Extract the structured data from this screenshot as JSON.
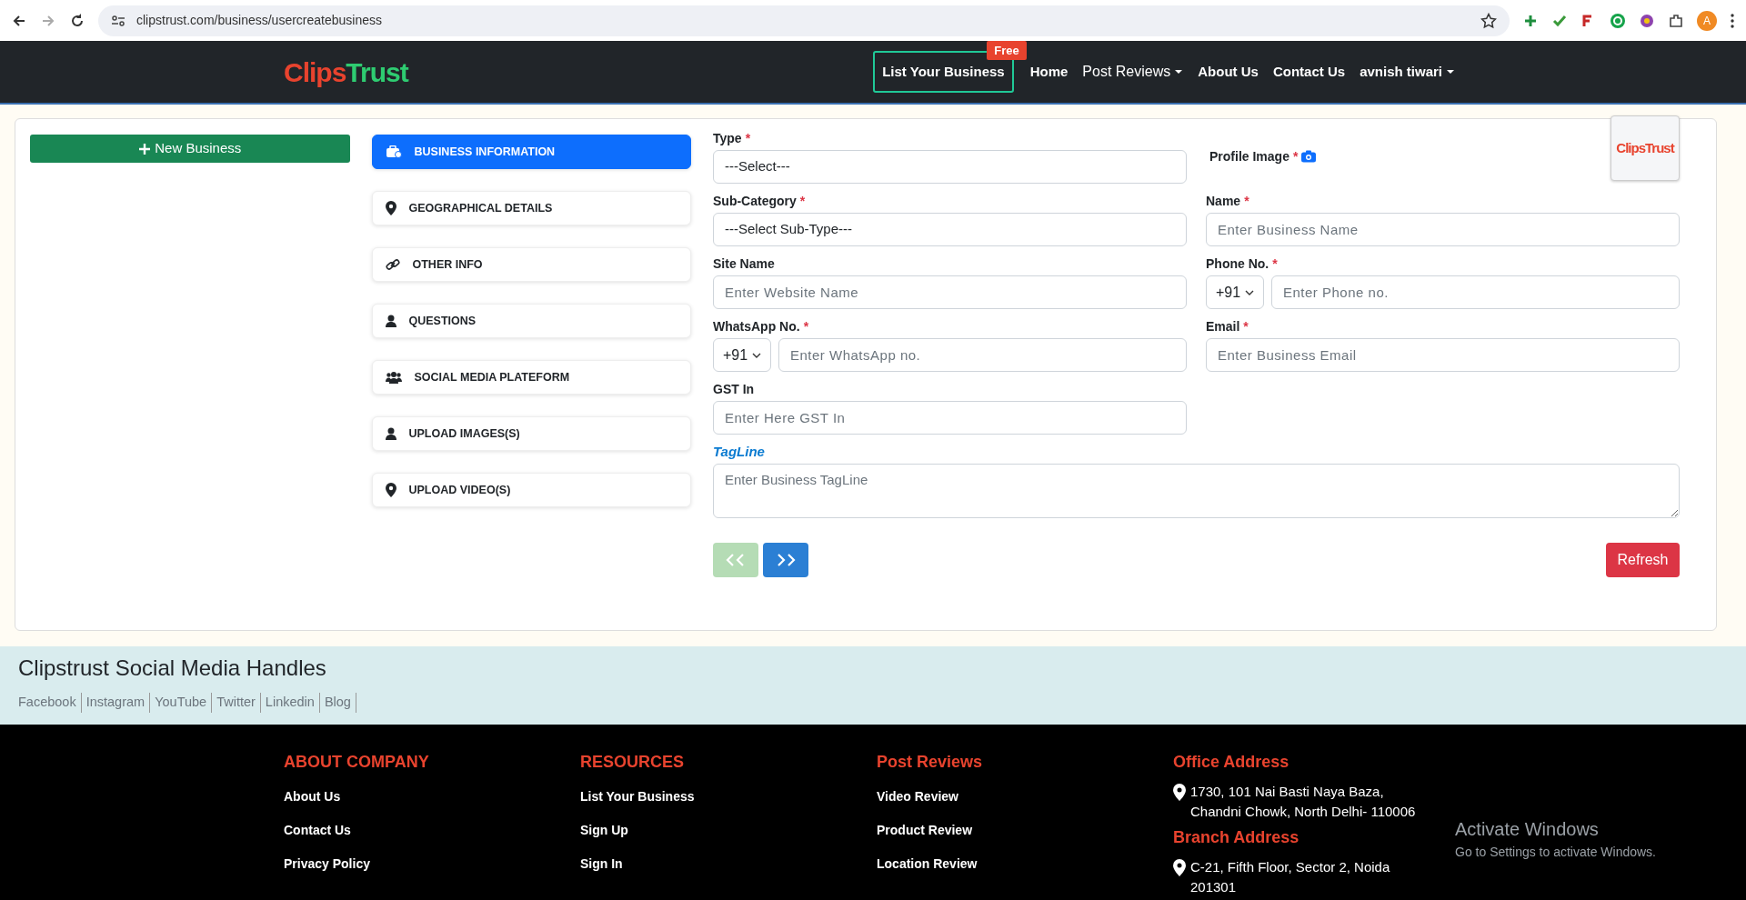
{
  "browser": {
    "url": "clipstrust.com/business/usercreatebusiness",
    "avatar": "A"
  },
  "navbar": {
    "logo": {
      "first": "Clips",
      "second": "Trust"
    },
    "items": [
      {
        "label": "List Your Business",
        "kind": "boxed",
        "badge": "Free"
      },
      {
        "label": "Home",
        "kind": "link"
      },
      {
        "label": "Post Reviews",
        "kind": "dropdown"
      },
      {
        "label": "About Us",
        "kind": "link"
      },
      {
        "label": "Contact Us",
        "kind": "link"
      },
      {
        "label": "avnish tiwari",
        "kind": "dropdown"
      }
    ]
  },
  "new_business_button": "New Business",
  "steps": [
    {
      "label": "BUSINESS INFORMATION",
      "selected": true
    },
    {
      "label": "GEOGRAPHICAL DETAILS",
      "selected": false
    },
    {
      "label": "OTHER INFO",
      "selected": false
    },
    {
      "label": "QUESTIONS",
      "selected": false
    },
    {
      "label": "SOCIAL MEDIA PLATEFORM",
      "selected": false
    },
    {
      "label": "UPLOAD IMAGES(S)",
      "selected": false
    },
    {
      "label": "UPLOAD VIDEO(S)",
      "selected": false
    }
  ],
  "form": {
    "fields": [
      {
        "kind": "select",
        "label": "Type",
        "mark": "*",
        "value": "---Select---"
      },
      {
        "kind": "profile",
        "label": "Profile Image",
        "mark": "*",
        "image_text": "ClipsTrust"
      },
      {
        "kind": "select",
        "label": "Sub-Category",
        "mark": "*",
        "value": "---Select Sub-Type---"
      },
      {
        "kind": "text",
        "label": "Name",
        "mark": "*",
        "placeholder": "Enter Business Name"
      },
      {
        "kind": "text",
        "label": "Site Name",
        "placeholder": "Enter Website Name"
      },
      {
        "kind": "phone",
        "label": "Phone No.",
        "mark": "*",
        "code": "+91",
        "placeholder": "Enter Phone no."
      },
      {
        "kind": "phone",
        "label": "WhatsApp No.",
        "mark": "*",
        "code": "+91",
        "placeholder": "Enter WhatsApp no."
      },
      {
        "kind": "text",
        "label": "Email",
        "mark": "*",
        "placeholder": "Enter Business Email"
      },
      {
        "kind": "text",
        "label": "GST In",
        "placeholder": "Enter Here GST In"
      },
      {
        "kind": "textarea",
        "label": "TagLine",
        "placeholder": "Enter Business TagLine"
      }
    ],
    "prev_disabled": true,
    "next_disabled": false,
    "refresh": "Refresh"
  },
  "social": {
    "title": "Clipstrust Social Media Handles",
    "links": [
      "Facebook",
      "Instagram",
      "YouTube",
      "Twitter",
      "Linkedin",
      "Blog"
    ]
  },
  "footer": {
    "columns": [
      {
        "title": "ABOUT COMPANY",
        "links": [
          "About Us",
          "Contact Us",
          "Privacy Policy"
        ]
      },
      {
        "title": "RESOURCES",
        "links": [
          "List Your Business",
          "Sign Up",
          "Sign In"
        ]
      },
      {
        "title": "Post Reviews",
        "links": [
          "Video Review",
          "Product Review",
          "Location Review"
        ]
      }
    ],
    "addresses": [
      {
        "title": "Office Address",
        "text": "1730, 101 Nai Basti Naya Baza, Chandni Chowk, North Delhi- 110006"
      },
      {
        "title": "Branch Address",
        "text": "C-21, Fifth Floor, Sector 2, Noida 201301"
      }
    ]
  },
  "os_notice": {
    "title": "Activate Windows",
    "text": "Go to Settings to activate Windows."
  }
}
